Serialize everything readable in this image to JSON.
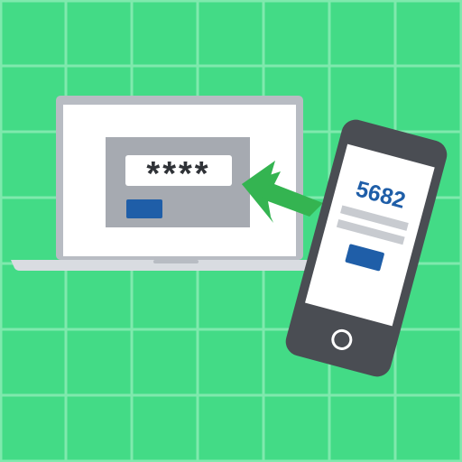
{
  "illustration": {
    "colors": {
      "background": "#43db86",
      "grid_lines": "#7fe9ad",
      "laptop_body": "#b8bcc3",
      "laptop_base": "#d9dce1",
      "screen": "#ffffff",
      "dialog": "#a6aab1",
      "accent_blue": "#1f5ea8",
      "arrow": "#34b451",
      "phone_body": "#4a4d53",
      "phone_screen": "#ffffff",
      "placeholder_bar": "#c8cbd0"
    },
    "laptop": {
      "password_mask": "****",
      "submit_button_label": ""
    },
    "phone": {
      "code": "5682",
      "confirm_button_label": ""
    },
    "arrow_direction": "left"
  }
}
